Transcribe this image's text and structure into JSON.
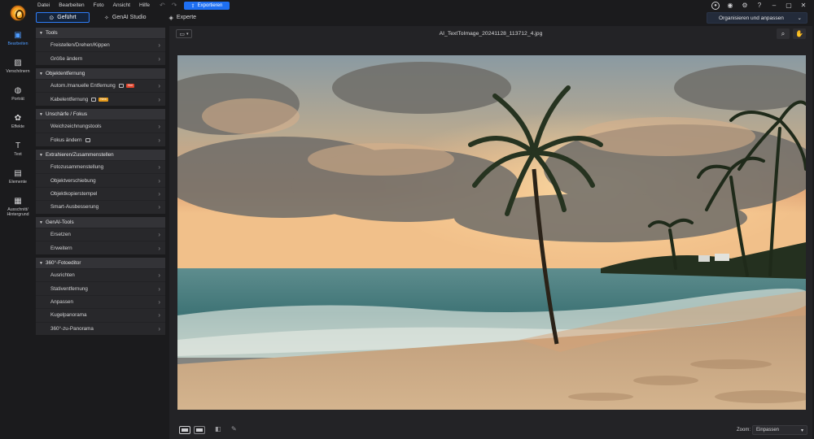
{
  "menu": [
    "Datei",
    "Bearbeiten",
    "Foto",
    "Ansicht",
    "Hilfe"
  ],
  "export_label": "Exportieren",
  "modes": [
    {
      "label": "Geführt",
      "active": true,
      "icon": "compass-icon"
    },
    {
      "label": "GenAI Studio",
      "active": false,
      "icon": "sparkle-icon"
    },
    {
      "label": "Experte",
      "active": false,
      "icon": "cube-icon"
    }
  ],
  "workspace_select": "Organisieren und anpassen",
  "rail": [
    {
      "label": "Bearbeiten",
      "icon": "edit-photo-icon",
      "active": true
    },
    {
      "label": "Verschönern",
      "icon": "beautify-icon",
      "active": false
    },
    {
      "label": "Porträt",
      "icon": "portrait-icon",
      "active": false
    },
    {
      "label": "Effekte",
      "icon": "effects-icon",
      "active": false
    },
    {
      "label": "Text",
      "icon": "text-icon",
      "active": false
    },
    {
      "label": "Elemente",
      "icon": "elements-icon",
      "active": false
    },
    {
      "label": "Ausschnitt/\nHintergrund",
      "icon": "cutout-background-icon",
      "active": false
    }
  ],
  "sections": [
    {
      "title": "Tools",
      "items": [
        {
          "label": "Freistellen/Drehen/Kippen"
        },
        {
          "label": "Größe ändern"
        }
      ]
    },
    {
      "title": "Objektentfernung",
      "items": [
        {
          "label": "Autom./manuelle Entfernung",
          "badge": "Hot",
          "badge_type": "hot",
          "ai_icon": true
        },
        {
          "label": "Kabelentfernung",
          "badge": "New",
          "badge_type": "new",
          "ai_icon": true
        }
      ]
    },
    {
      "title": "Unschärfe / Fokus",
      "items": [
        {
          "label": "Weichzeichnungstools"
        },
        {
          "label": "Fokus ändern",
          "ai_icon": true
        }
      ]
    },
    {
      "title": "Extrahieren/Zusammenstellen",
      "items": [
        {
          "label": "Fotozusammenstellung"
        },
        {
          "label": "Objektverschiebung"
        },
        {
          "label": "Objektkopierstempel"
        },
        {
          "label": "Smart-Ausbesserung"
        }
      ]
    },
    {
      "title": "GenAI-Tools",
      "items": [
        {
          "label": "Ersetzen"
        },
        {
          "label": "Erweitern"
        }
      ]
    },
    {
      "title": "360°-Fotoeditor",
      "items": [
        {
          "label": "Ausrichten"
        },
        {
          "label": "Stativentfernung"
        },
        {
          "label": "Anpassen"
        },
        {
          "label": "Kugelpanorama"
        },
        {
          "label": "360°-zu-Panorama"
        }
      ]
    }
  ],
  "file_name": "AI_TextToImage_20241128_113712_4.jpg",
  "zoom_label": "Zoom:",
  "zoom_value": "Einpassen",
  "colors": {
    "accent": "#2e7cf6",
    "export": "#1e6ff2",
    "panel": "#28282b",
    "panel_header": "#333337"
  }
}
